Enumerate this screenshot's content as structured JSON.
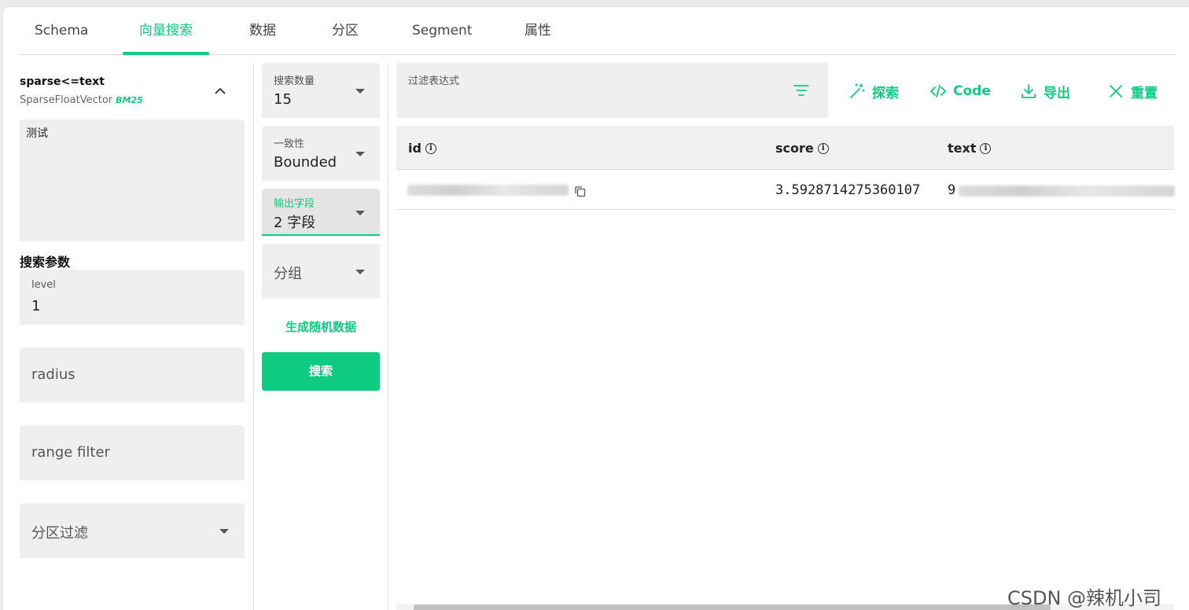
{
  "tabs": [
    {
      "label": "Schema"
    },
    {
      "label": "向量搜索"
    },
    {
      "label": "数据"
    },
    {
      "label": "分区"
    },
    {
      "label": "Segment"
    },
    {
      "label": "属性"
    }
  ],
  "active_tab": "向量搜索",
  "accent_color": "#0ecb81",
  "vector_field": {
    "name": "sparse<=text",
    "type": "SparseFloatVector",
    "metric": "BM25",
    "query_text": "测试"
  },
  "search_params": {
    "title": "搜索参数",
    "level_label": "level",
    "level_value": "1",
    "radius_placeholder": "radius",
    "range_filter_placeholder": "range filter",
    "partition_filter_placeholder": "分区过滤"
  },
  "options": {
    "topk_label": "搜索数量",
    "topk_value": "15",
    "consistency_label": "一致性",
    "consistency_value": "Bounded",
    "output_label": "输出字段",
    "output_value": "2 字段",
    "group_placeholder": "分组",
    "generate_label": "生成随机数据",
    "search_label": "搜索"
  },
  "filter": {
    "label": "过滤表达式"
  },
  "actions": [
    {
      "label": "探索",
      "icon": "magic-wand-icon"
    },
    {
      "label": "Code",
      "icon": "code-icon"
    },
    {
      "label": "导出",
      "icon": "download-icon"
    },
    {
      "label": "重置",
      "icon": "close-icon"
    }
  ],
  "table": {
    "columns": [
      "id",
      "score",
      "text"
    ],
    "rows": [
      {
        "id": "",
        "score": "3.5928714275360107",
        "text": "9"
      }
    ]
  },
  "watermark": "CSDN @辣机小司"
}
